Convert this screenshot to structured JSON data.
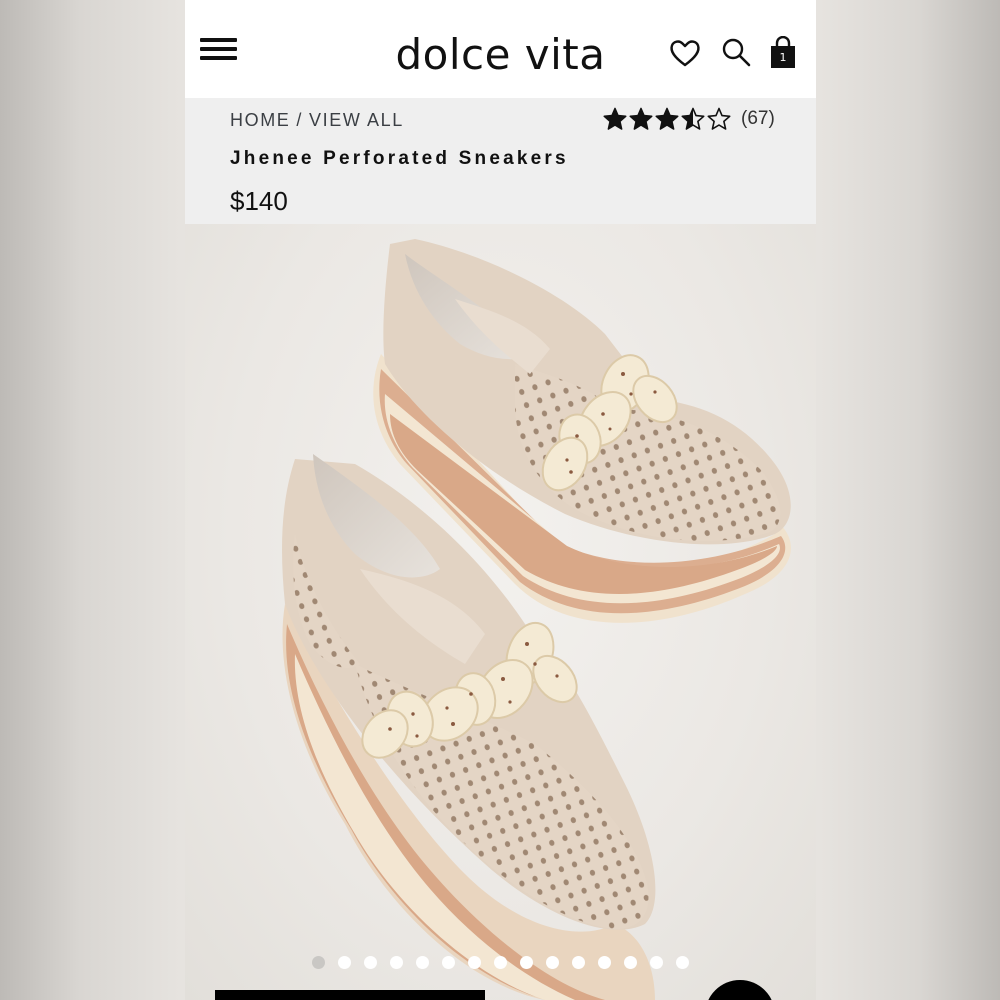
{
  "header": {
    "logo": "dolce vita",
    "menu_icon": "hamburger-menu-icon",
    "wishlist_icon": "heart-icon",
    "search_icon": "search-icon",
    "cart_icon": "shopping-bag-icon",
    "cart_count": "1"
  },
  "breadcrumb": {
    "home": "HOME",
    "separator": "/",
    "current": "VIEW ALL"
  },
  "rating": {
    "stars": 3.5,
    "max_stars": 5,
    "review_count": "(67)"
  },
  "product": {
    "title": "Jhenee Perforated Sneakers",
    "price": "$140"
  },
  "gallery": {
    "image_count": 15,
    "active_index": 0
  },
  "colors": {
    "accent": "#111111",
    "info_background": "#efefef",
    "shoe_leather": "#e3d3c2",
    "sole_stripe": "#dcae90",
    "chain": "#f2e7cf"
  }
}
